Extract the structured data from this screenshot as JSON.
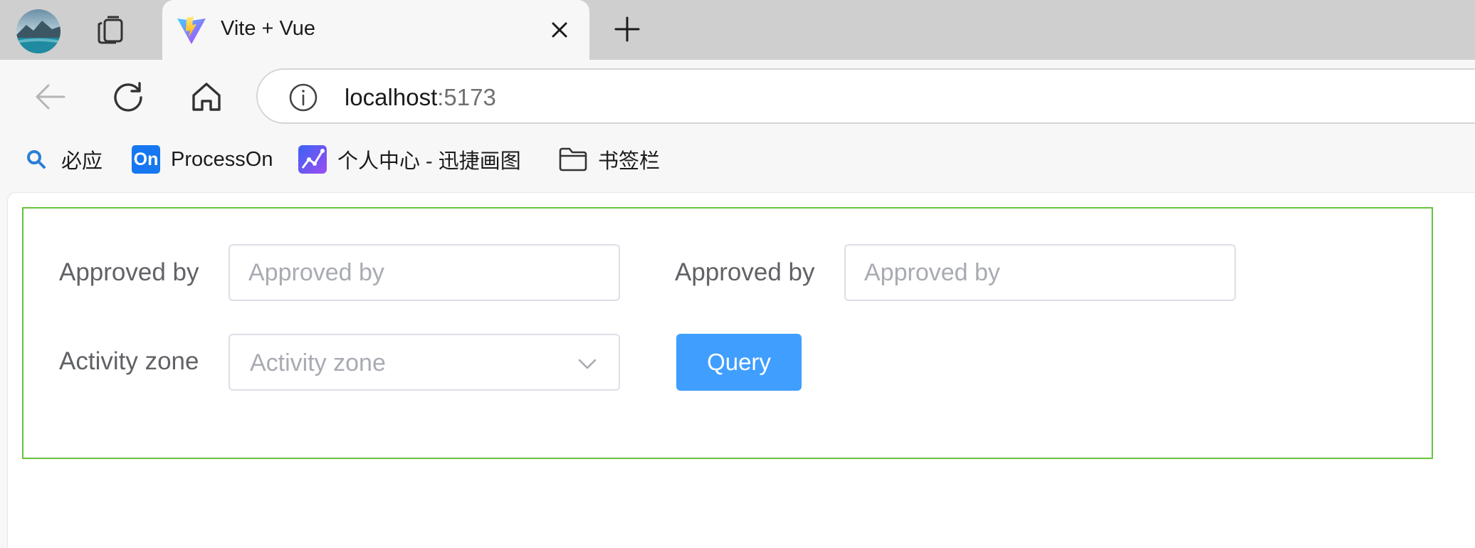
{
  "browser": {
    "tab": {
      "title": "Vite + Vue"
    },
    "address": {
      "host": "localhost",
      "port": ":5173"
    },
    "bookmarks": [
      {
        "label": "必应",
        "icon": "search-icon"
      },
      {
        "label": "ProcessOn",
        "icon": "processon-icon",
        "badge": "On"
      },
      {
        "label": "个人中心 - 迅捷画图",
        "icon": "chart-app-icon"
      },
      {
        "label": "书签栏",
        "icon": "folder-icon"
      }
    ]
  },
  "form": {
    "row1": {
      "field1": {
        "label": "Approved by",
        "placeholder": "Approved by"
      },
      "field2": {
        "label": "Approved by",
        "placeholder": "Approved by"
      }
    },
    "row2": {
      "zone": {
        "label": "Activity zone",
        "placeholder": "Activity zone"
      },
      "query_label": "Query"
    }
  },
  "colors": {
    "form_border": "#67c23a",
    "primary_button": "#409eff",
    "label_text": "#606266",
    "placeholder_text": "#a8abb2"
  }
}
